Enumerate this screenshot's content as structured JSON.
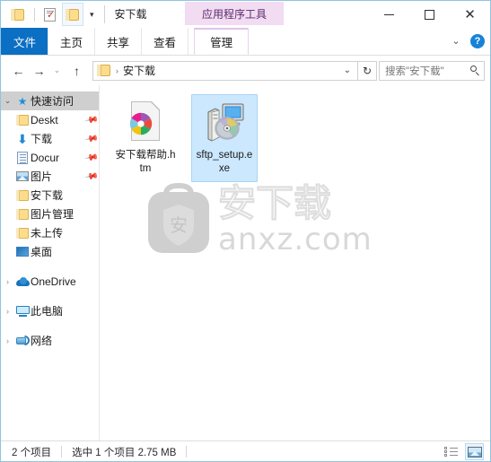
{
  "window": {
    "title": "安下载",
    "contextual_tab_band": "应用程序工具",
    "quick_access": {
      "folder_icon": "folder-icon",
      "properties_icon": "properties-checkmark-icon",
      "new_folder_icon": "new-folder-icon",
      "customize_caret": "▾"
    },
    "controls": {
      "minimize": "minimize-icon",
      "maximize": "maximize-icon",
      "close": "✕"
    }
  },
  "ribbon": {
    "tabs": [
      {
        "label": "文件",
        "type": "file"
      },
      {
        "label": "主页",
        "type": "normal"
      },
      {
        "label": "共享",
        "type": "normal"
      },
      {
        "label": "查看",
        "type": "normal"
      },
      {
        "label": "管理",
        "type": "contextual"
      }
    ],
    "collapse_caret": "⌄",
    "help_label": "?"
  },
  "address": {
    "back": "←",
    "forward": "→",
    "recent_caret": "⌄",
    "up": "↑",
    "crumb_separator": "›",
    "crumb_label": "安下载",
    "dropdown_caret": "⌄",
    "refresh": "↻",
    "search_placeholder": "搜索\"安下载\""
  },
  "sidebar": {
    "items": [
      {
        "label": "快速访问",
        "icon": "star-pin-icon",
        "chevron": "⌄",
        "selected": true,
        "pinned": false
      },
      {
        "label": "Deskt",
        "icon": "folder-icon",
        "child": true,
        "pinned": true
      },
      {
        "label": "下载",
        "icon": "download-arrow-icon",
        "child": true,
        "pinned": true
      },
      {
        "label": "Docur",
        "icon": "documents-icon",
        "child": true,
        "pinned": true
      },
      {
        "label": "图片",
        "icon": "pictures-icon",
        "child": true,
        "pinned": true
      },
      {
        "label": "安下载",
        "icon": "folder-icon",
        "child": true,
        "pinned": false
      },
      {
        "label": "图片管理",
        "icon": "folder-icon",
        "child": true,
        "pinned": false
      },
      {
        "label": "未上传",
        "icon": "folder-icon",
        "child": true,
        "pinned": false
      },
      {
        "label": "桌面",
        "icon": "desktop-icon",
        "child": true,
        "pinned": false
      },
      {
        "label": "OneDrive",
        "icon": "onedrive-cloud-icon",
        "chevron": "›",
        "selected": false
      },
      {
        "label": "此电脑",
        "icon": "this-pc-icon",
        "chevron": "›",
        "selected": false
      },
      {
        "label": "网络",
        "icon": "network-icon",
        "chevron": "›",
        "selected": false
      }
    ]
  },
  "files": [
    {
      "name": "安下载帮助.htm",
      "icon": "html-document-icon",
      "selected": false
    },
    {
      "name": "sftp_setup.exe",
      "icon": "setup-executable-icon",
      "selected": true
    }
  ],
  "watermark": {
    "logo_char": "安",
    "brand_text": "安下载",
    "domain": "anxz.com"
  },
  "statusbar": {
    "item_count": "2 个项目",
    "selection": "选中 1 个项目  2.75 MB",
    "views": [
      {
        "name": "details-view",
        "active": false
      },
      {
        "name": "large-icons-view",
        "active": true
      }
    ]
  },
  "colors": {
    "accent": "#0b6fc4",
    "selection": "#cce8ff",
    "contextual": "#f2dcf2",
    "window_border": "#8fc4e0"
  }
}
